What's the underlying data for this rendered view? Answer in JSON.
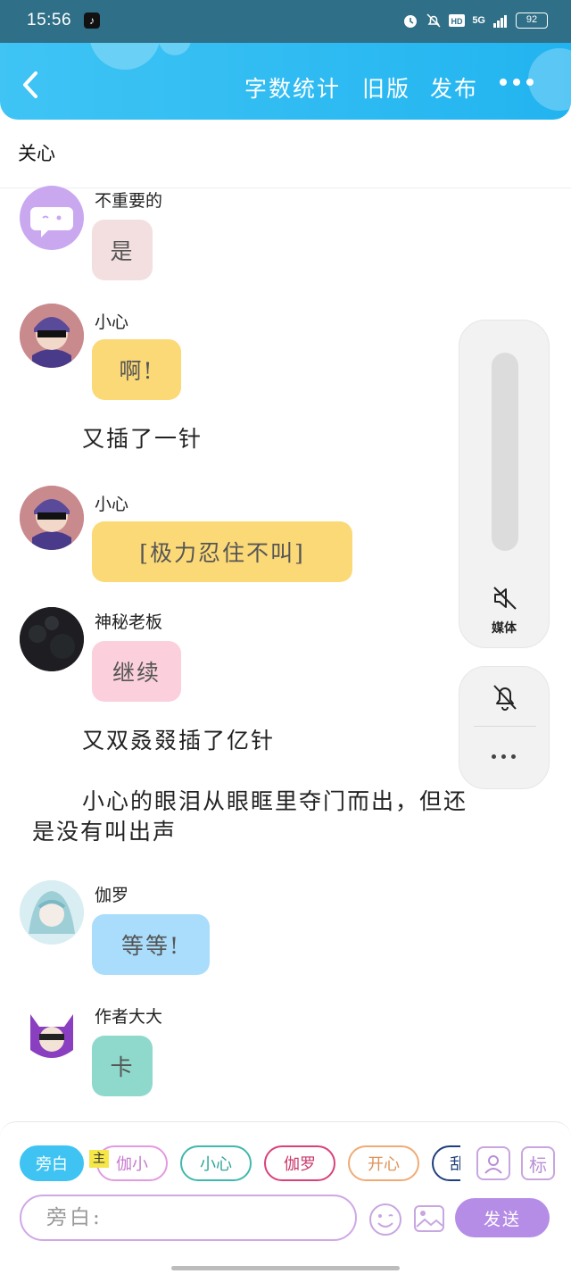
{
  "status_bar": {
    "time": "15:56",
    "signal": "5G",
    "battery": "92"
  },
  "header": {
    "word_count": "字数统计",
    "old_version": "旧版",
    "publish": "发布"
  },
  "chapter": {
    "title": "关心"
  },
  "messages": [
    {
      "speaker": "不重要的",
      "text": "是",
      "bubble_color": "#f3dfe0"
    },
    {
      "speaker": "小心",
      "text": "啊!",
      "bubble_color": "#fcd977"
    },
    {
      "speaker": "小心",
      "text": "[极力忍住不叫]",
      "bubble_color": "#fcd977"
    },
    {
      "speaker": "神秘老板",
      "text": "继续",
      "bubble_color": "#fbd0dc"
    },
    {
      "speaker": "伽罗",
      "text": "等等!",
      "bubble_color": "#a9ddfb"
    },
    {
      "speaker": "作者大大",
      "text": "卡",
      "bubble_color": "#8fd9cc"
    }
  ],
  "narrations": [
    "又插了一针",
    "又双叒叕插了亿针",
    "小心的眼泪从眼眶里夺门而出，但还",
    "是没有叫出声"
  ],
  "volume_panel": {
    "media_label": "媒体"
  },
  "bottom": {
    "roles": [
      "旁白",
      "伽小",
      "小心",
      "伽罗",
      "开心",
      "乱"
    ],
    "host_badge": "主",
    "mark_tool": "标",
    "input_placeholder": "旁白:",
    "send_label": "发送"
  }
}
